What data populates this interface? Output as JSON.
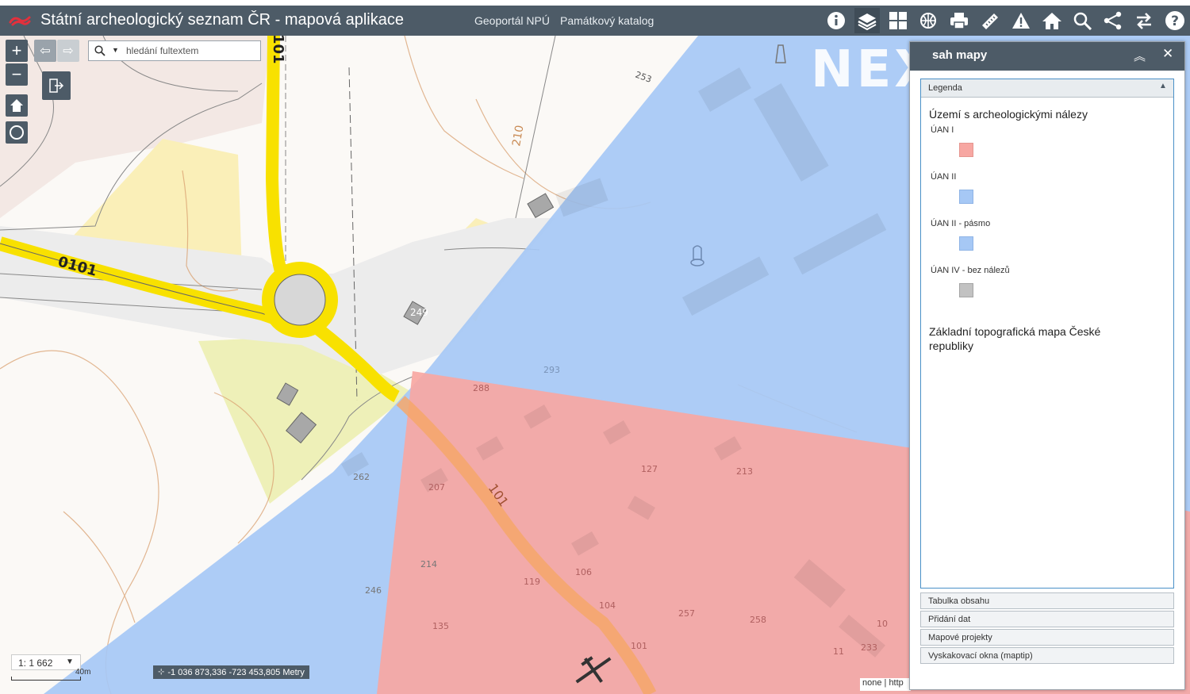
{
  "header": {
    "title": "Státní archeologický seznam ČR - mapová aplikace",
    "links": [
      "Geoportál NPÚ",
      "Památkový katalog"
    ],
    "tools": [
      "info-icon",
      "layers-icon",
      "basemap-gallery-icon",
      "map-switch-icon",
      "print-icon",
      "measure-icon",
      "warning-icon",
      "home-icon",
      "search-icon",
      "share-icon",
      "swap-icon",
      "help-icon"
    ]
  },
  "map": {
    "search": {
      "placeholder": "hledání fultextem"
    },
    "scale": {
      "value": "1: 1 662",
      "bar_label": "40m"
    },
    "coords": "-1 036 873,336 -723 453,805 Metry",
    "attribution": "none | http",
    "watermark": "NEXT",
    "labels": {
      "road_101": "101",
      "road_0101": "0101",
      "h210": "210",
      "n253": "253",
      "n249": "249",
      "n262": "262",
      "n246": "246",
      "n214": "214",
      "n207": "207",
      "n213": "213",
      "n127": "127",
      "n135": "135",
      "n106": "106",
      "n104": "104",
      "n101": "101",
      "n119": "119",
      "n258": "258",
      "n257": "257",
      "n10": "10",
      "n11": "11",
      "n233": "233",
      "n288": "288",
      "n293": "293"
    },
    "colors": {
      "uan1": "#f7a7a2",
      "uan2": "#a6c8f5",
      "uan4": "#c2c2c2",
      "road_main": "#f8e100",
      "yellow_area": "#faefb8"
    }
  },
  "panel": {
    "title": "sah mapy",
    "legend_header": "Legenda",
    "groups": {
      "g1": "Území s archeologickými nálezy",
      "g2": "Základní topografická mapa České republiky"
    },
    "items": [
      {
        "label": "ÚAN I",
        "color": "#f7a7a2"
      },
      {
        "label": "ÚAN II",
        "color": "#a6c8f5"
      },
      {
        "label": "ÚAN II - pásmo",
        "color": "#a6c8f5"
      },
      {
        "label": "ÚAN IV - bez nálezů",
        "color": "#c2c2c2"
      }
    ],
    "sections": [
      "Tabulka obsahu",
      "Přidání dat",
      "Mapové projekty",
      "Vyskakovací okna (maptip)"
    ]
  }
}
